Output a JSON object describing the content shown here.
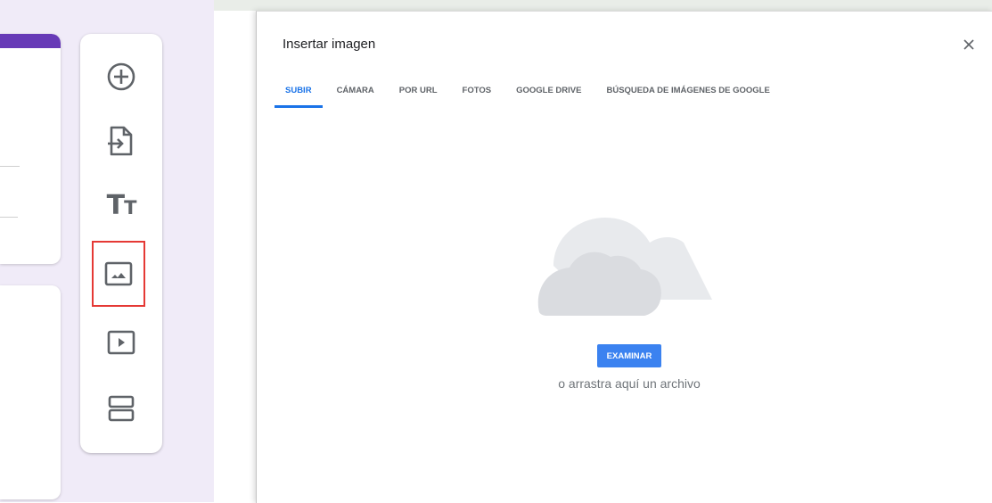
{
  "dialog": {
    "title": "Insertar imagen",
    "close_icon": "close-icon",
    "tabs": [
      {
        "label": "SUBIR",
        "active": true
      },
      {
        "label": "CÁMARA",
        "active": false
      },
      {
        "label": "POR URL",
        "active": false
      },
      {
        "label": "FOTOS",
        "active": false
      },
      {
        "label": "GOOGLE DRIVE",
        "active": false
      },
      {
        "label": "BÚSQUEDA DE IMÁGENES DE GOOGLE",
        "active": false
      }
    ],
    "upload": {
      "illustration": "cloud-icon",
      "browse_label": "EXAMINAR",
      "drag_text": "o arrastra aquí un archivo"
    }
  },
  "toolbar": {
    "items": [
      {
        "name": "add-question",
        "icon": "add-circle-icon"
      },
      {
        "name": "import-questions",
        "icon": "import-icon"
      },
      {
        "name": "add-title",
        "icon": "title-icon",
        "text": "Tт"
      },
      {
        "name": "add-image",
        "icon": "image-icon",
        "selected": true
      },
      {
        "name": "add-video",
        "icon": "video-icon"
      },
      {
        "name": "add-section",
        "icon": "section-icon"
      }
    ]
  },
  "colors": {
    "accent": "#1a73e8",
    "button": "#3b82f0",
    "form_header": "#673ab7",
    "editor_background": "#f0ebf8",
    "highlight": "#e53935"
  }
}
